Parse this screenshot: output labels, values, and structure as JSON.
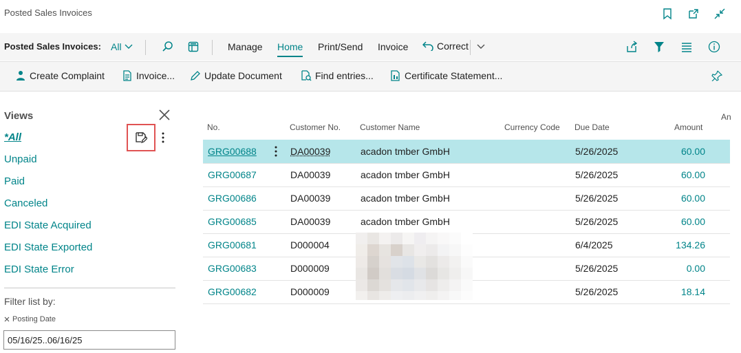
{
  "window": {
    "title": "Posted Sales Invoices"
  },
  "actionbar": {
    "page_label": "Posted Sales Invoices:",
    "view_selector": "All",
    "menus": [
      "Manage",
      "Home",
      "Print/Send",
      "Invoice",
      "Correct"
    ]
  },
  "subbar": {
    "actions": [
      "Create Complaint",
      "Invoice...",
      "Update Document",
      "Find entries...",
      "Certificate Statement..."
    ]
  },
  "views": {
    "title": "Views",
    "items": [
      "*All",
      "Unpaid",
      "Paid",
      "Canceled",
      "EDI State Acquired",
      "EDI State Exported",
      "EDI State Error"
    ],
    "filter_title": "Filter list by:",
    "filter_field": "Posting Date",
    "filter_value": "05/16/25..06/16/25"
  },
  "grid": {
    "columns": [
      "No.",
      "Customer No.",
      "Customer Name",
      "Currency Code",
      "Due Date",
      "Amount",
      "An"
    ],
    "rows": [
      {
        "no": "GRG00688",
        "customer_no": "DA00039",
        "customer_name": "acadon tmber GmbH",
        "currency": "",
        "due_date": "5/26/2025",
        "amount": "60.00"
      },
      {
        "no": "GRG00687",
        "customer_no": "DA00039",
        "customer_name": "acadon tmber GmbH",
        "currency": "",
        "due_date": "5/26/2025",
        "amount": "60.00"
      },
      {
        "no": "GRG00686",
        "customer_no": "DA00039",
        "customer_name": "acadon tmber GmbH",
        "currency": "",
        "due_date": "5/26/2025",
        "amount": "60.00"
      },
      {
        "no": "GRG00685",
        "customer_no": "DA00039",
        "customer_name": "acadon tmber GmbH",
        "currency": "",
        "due_date": "5/26/2025",
        "amount": "60.00"
      },
      {
        "no": "GRG00681",
        "customer_no": "D000004",
        "customer_name": "",
        "currency": "",
        "due_date": "6/4/2025",
        "amount": "134.26"
      },
      {
        "no": "GRG00683",
        "customer_no": "D000009",
        "customer_name": "",
        "currency": "",
        "due_date": "5/26/2025",
        "amount": "0.00"
      },
      {
        "no": "GRG00682",
        "customer_no": "D000009",
        "customer_name": "",
        "currency": "",
        "due_date": "5/26/2025",
        "amount": "18.14"
      }
    ]
  },
  "colors": {
    "accent": "#008489",
    "selected_row": "#b6e6ea",
    "highlight_box": "#e05252"
  }
}
